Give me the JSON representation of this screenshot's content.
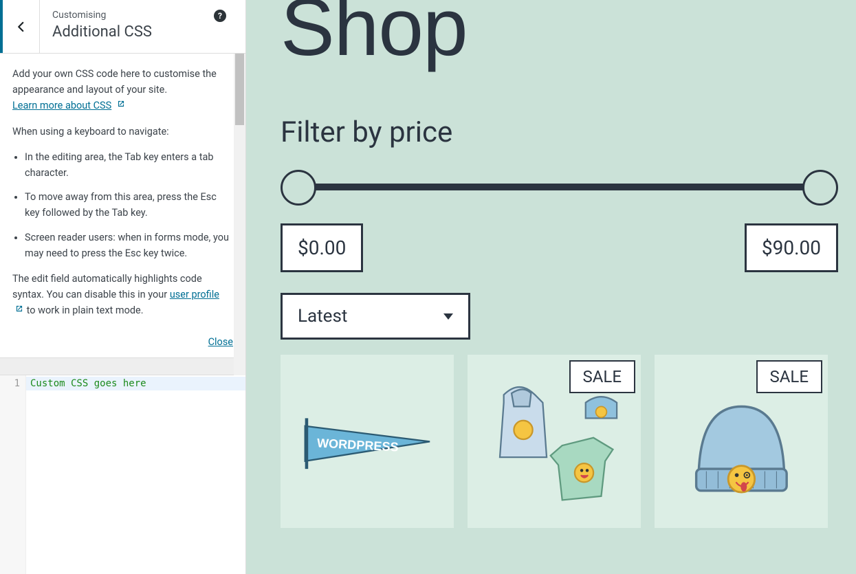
{
  "panel": {
    "supertitle": "Customising",
    "title": "Additional CSS",
    "help_tooltip": "Help",
    "intro": "Add your own CSS code here to customise the appearance and layout of your site.",
    "learn_link": "Learn more about CSS",
    "keyboard_intro": "When using a keyboard to navigate:",
    "tips": [
      "In the editing area, the Tab key enters a tab character.",
      "To move away from this area, press the Esc key followed by the Tab key.",
      "Screen reader users: when in forms mode, you may need to press the Esc key twice."
    ],
    "syntax_note_a": "The edit field automatically highlights code syntax. You can disable this in your ",
    "user_profile_link": "user profile",
    "syntax_note_b": " to work in plain text mode.",
    "close": "Close"
  },
  "editor": {
    "line_number": "1",
    "content": "Custom CSS goes here"
  },
  "preview": {
    "page_title": "Shop",
    "filter_heading": "Filter by price",
    "price_min": "$0.00",
    "price_max": "$90.00",
    "sort_selected": "Latest",
    "sale_label": "SALE",
    "products": [
      {
        "name": "wordpress-pennant",
        "on_sale": false
      },
      {
        "name": "logo-collection",
        "on_sale": true
      },
      {
        "name": "beanie-with-logo",
        "on_sale": true
      }
    ]
  }
}
